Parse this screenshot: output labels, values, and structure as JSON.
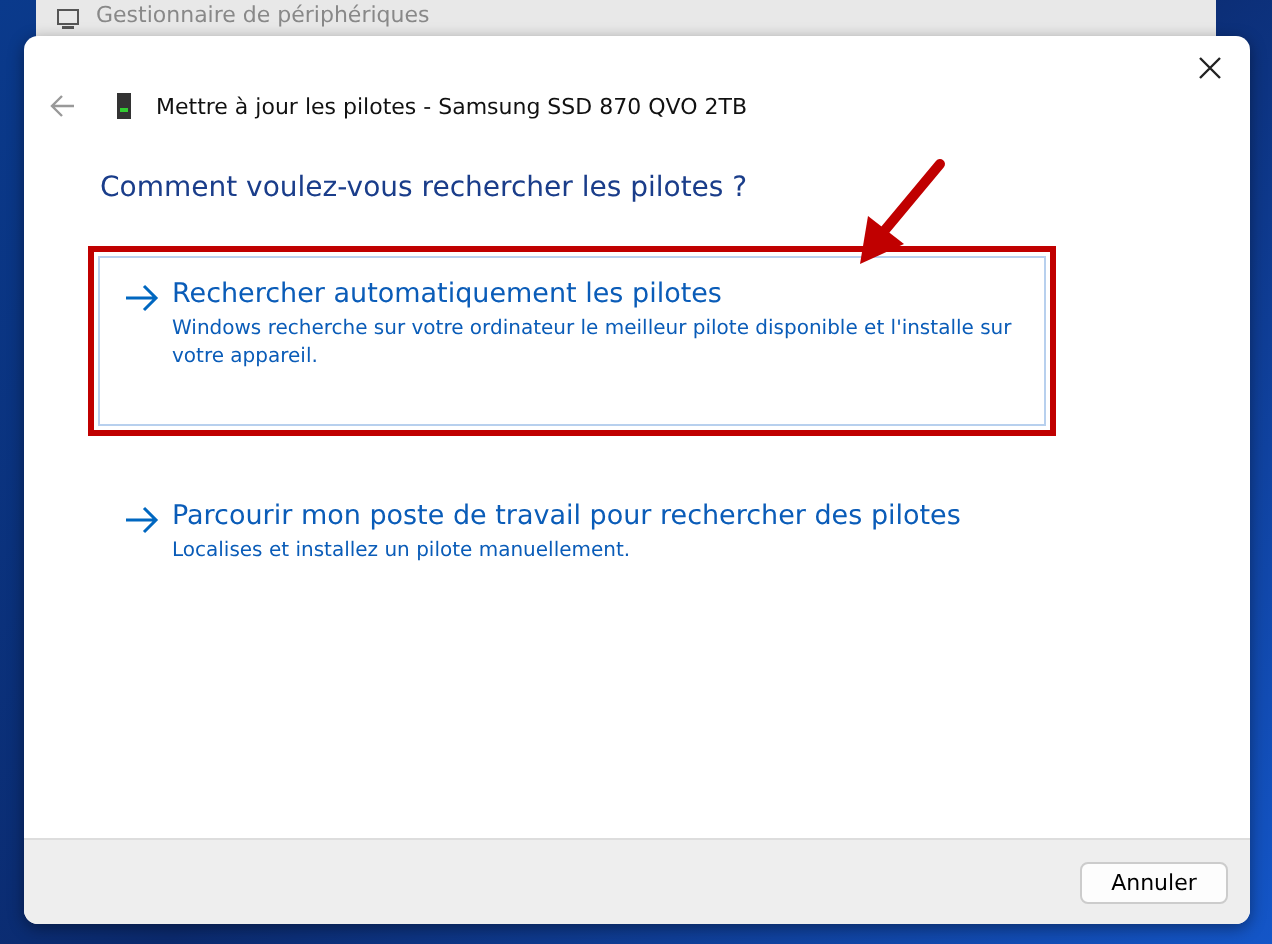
{
  "background_window": {
    "title": "Gestionnaire de périphériques"
  },
  "dialog": {
    "title": "Mettre à jour les pilotes - Samsung SSD 870 QVO 2TB",
    "question": "Comment voulez-vous rechercher les pilotes ?",
    "options": [
      {
        "title": "Rechercher automatiquement les pilotes",
        "description": "Windows recherche sur votre ordinateur le meilleur pilote disponible et l'installe sur votre appareil.",
        "highlighted": true
      },
      {
        "title": "Parcourir mon poste de travail pour rechercher des pilotes",
        "description": "Localises et installez un pilote manuellement.",
        "highlighted": false
      }
    ],
    "buttons": [
      "Annuler"
    ]
  }
}
